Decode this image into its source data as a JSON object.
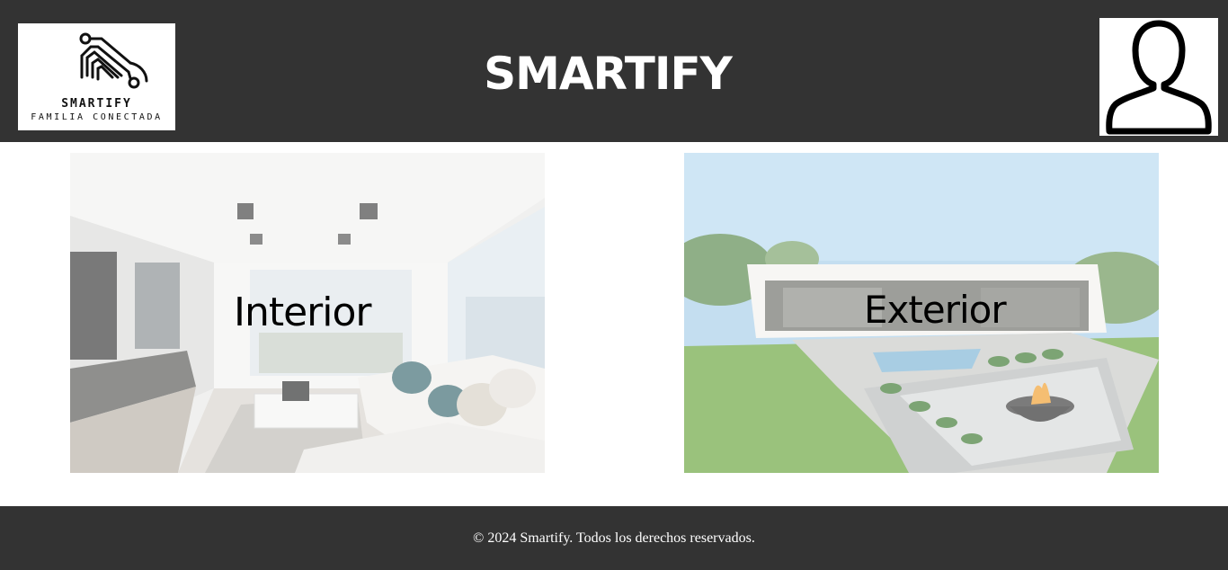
{
  "header": {
    "logo": {
      "title": "SMARTIFY",
      "subtitle": "FAMILIA CONECTADA",
      "icon": "smart-home-circuit-icon"
    },
    "site_title": "SMARTIFY",
    "profile": {
      "icon": "user-profile-icon"
    }
  },
  "sections": [
    {
      "label": "Interior",
      "image": "modern-living-room-photo"
    },
    {
      "label": "Exterior",
      "image": "modern-house-garden-firepit-photo"
    }
  ],
  "footer": {
    "text": "© 2024 Smartify. Todos los derechos reservados."
  },
  "colors": {
    "header_bg": "#333333",
    "footer_bg": "#333333",
    "title_text": "#ffffff",
    "page_bg": "#ffffff"
  }
}
